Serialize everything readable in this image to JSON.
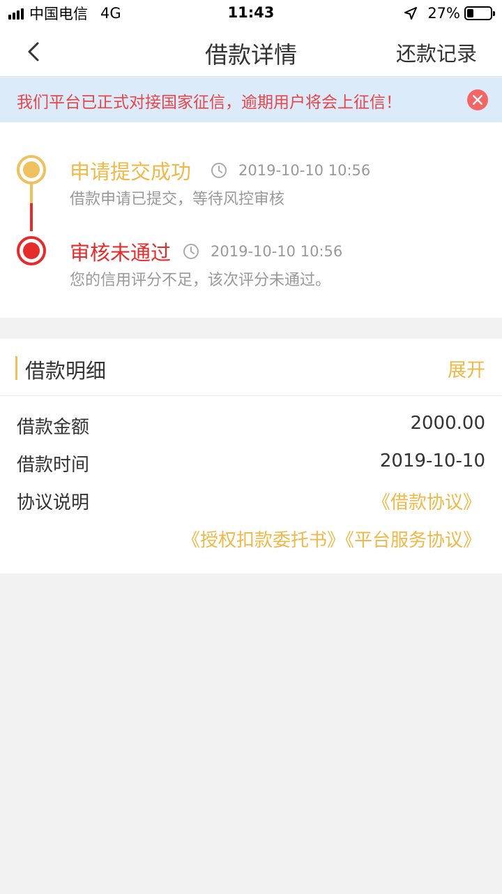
{
  "status_bar": {
    "carrier": "中国电信",
    "network": "4G",
    "time": "11:43",
    "battery_percent_label": "27%",
    "battery_level": 0.27
  },
  "nav": {
    "title": "借款详情",
    "right_action": "还款记录",
    "back_icon": "chevron-left-icon"
  },
  "notice": {
    "text": "我们平台已正式对接国家征信，逾期用户将会上征信！",
    "text_color": "#e6454a",
    "background": "#dcebfa"
  },
  "timeline": [
    {
      "title": "申请提交成功",
      "time": "2019-10-10 10:56",
      "description": "借款申请已提交，等待风控审核",
      "color": "#efc060"
    },
    {
      "title": "审核未通过",
      "time": "2019-10-10 10:56",
      "description": "您的信用评分不足，该次评分未通过。",
      "color": "#e62b2b"
    }
  ],
  "details": {
    "title": "借款明细",
    "expand_label": "展开",
    "rows": [
      {
        "label": "借款金额",
        "value": "2000.00"
      },
      {
        "label": "借款时间",
        "value": "2019-10-10"
      }
    ],
    "agreement_label": "协议说明",
    "agreements": [
      "《借款协议》",
      "《授权扣款委托书》《平台服务协议》"
    ]
  },
  "colors": {
    "accent": "#efb94a",
    "danger": "#e62b2b",
    "page_bg": "#f2f2f2"
  }
}
